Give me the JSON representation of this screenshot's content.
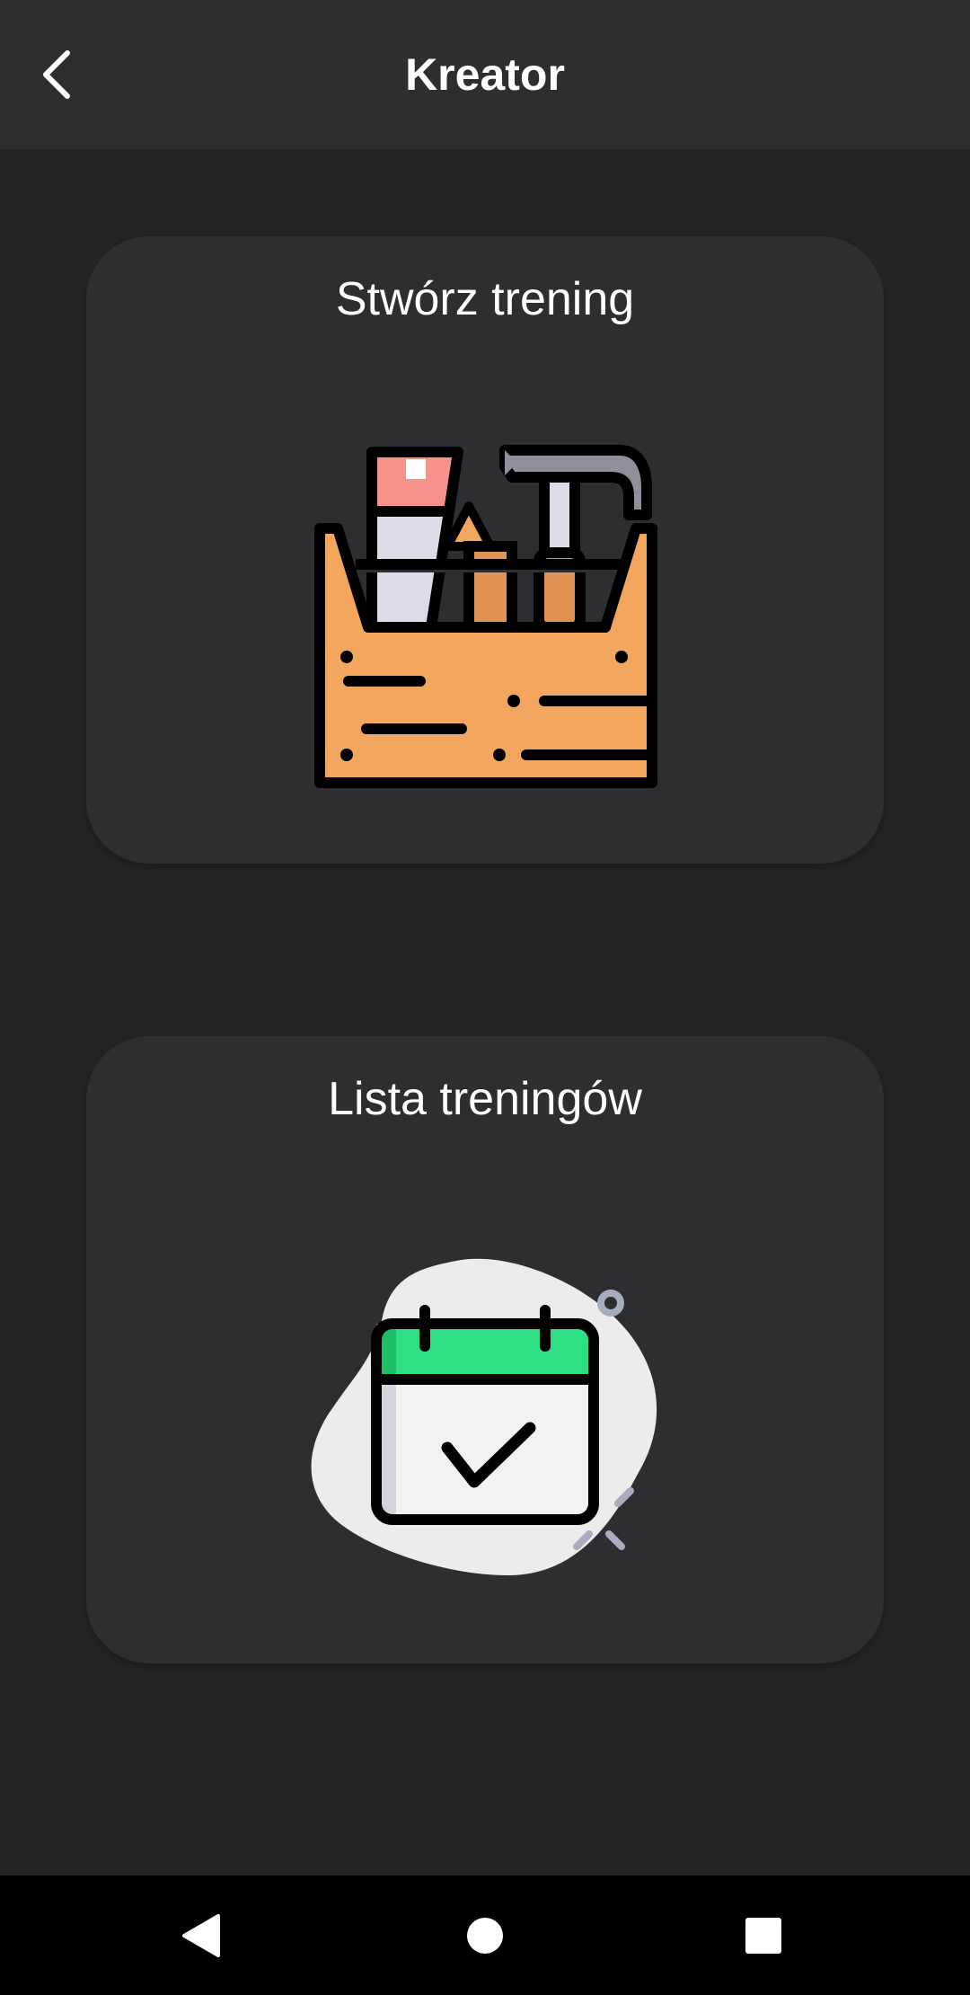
{
  "appbar": {
    "title": "Kreator",
    "back_icon": "chevron-left-icon"
  },
  "cards": [
    {
      "title": "Stwórz trening",
      "icon": "toolbox-icon"
    },
    {
      "title": "Lista treningów",
      "icon": "calendar-check-icon"
    }
  ],
  "navbar": {
    "back_icon": "triangle-back-icon",
    "home_icon": "circle-home-icon",
    "recents_icon": "square-recents-icon"
  },
  "colors": {
    "background": "#222427",
    "surface": "#2c2e32",
    "text": "#ffffff",
    "toolbox_orange": "#f2a65e",
    "calendar_green": "#2ede84"
  }
}
